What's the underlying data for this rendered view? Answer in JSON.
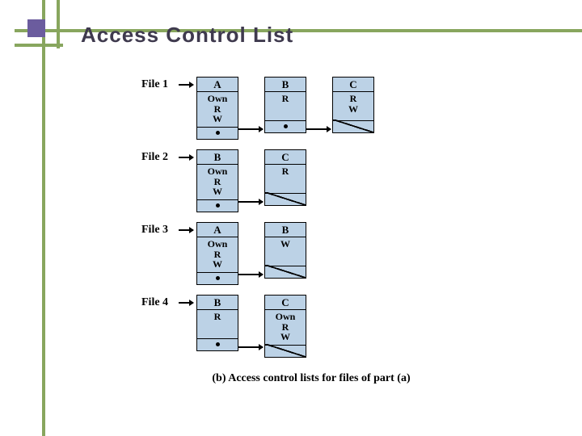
{
  "title": "Access Control List",
  "caption": "(b) Access control lists for files of part (a)",
  "files": [
    {
      "label": "File 1",
      "nodes": [
        {
          "user": "A",
          "perms": "Own\nR\nW",
          "next": true
        },
        {
          "user": "B",
          "perms": "R",
          "next": true
        },
        {
          "user": "C",
          "perms": "R\nW",
          "next": false
        }
      ]
    },
    {
      "label": "File 2",
      "nodes": [
        {
          "user": "B",
          "perms": "Own\nR\nW",
          "next": true
        },
        {
          "user": "C",
          "perms": "R",
          "next": false
        }
      ]
    },
    {
      "label": "File 3",
      "nodes": [
        {
          "user": "A",
          "perms": "Own\nR\nW",
          "next": true
        },
        {
          "user": "B",
          "perms": "W",
          "next": false
        }
      ]
    },
    {
      "label": "File 4",
      "nodes": [
        {
          "user": "B",
          "perms": "R",
          "next": true
        },
        {
          "user": "C",
          "perms": "Own\nR\nW",
          "next": false
        }
      ]
    }
  ]
}
